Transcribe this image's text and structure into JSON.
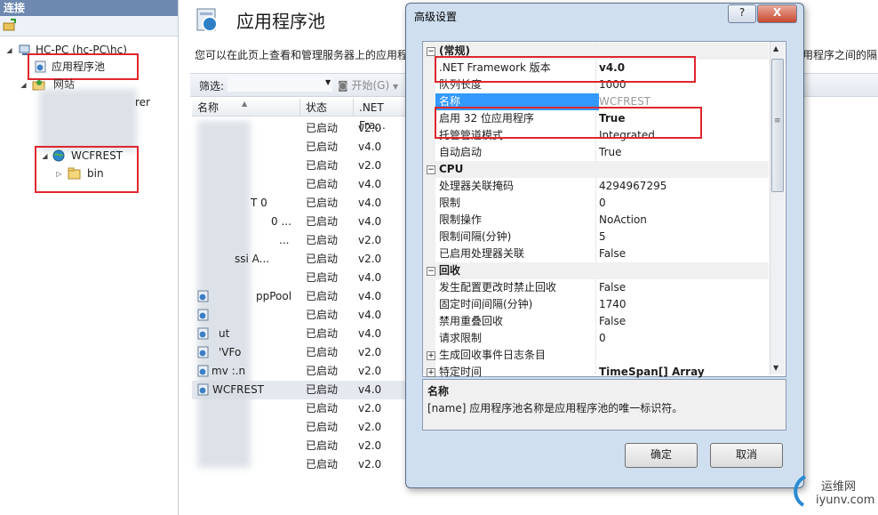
{
  "left_pane": {
    "header": "连接",
    "tree": {
      "server": "HC-PC (hc-PC\\hc)",
      "app_pools": "应用程序池",
      "sites": "网站",
      "partial_site": "rer",
      "wcfrest": "WCFREST",
      "bin": "bin"
    }
  },
  "main": {
    "title": "应用程序池",
    "description_left": "您可以在此页上查看和管理服务器上的应用程",
    "description_right": "用程序之间的隔",
    "filter_label": "筛选:",
    "start_label": "开始(G)",
    "columns": {
      "name": "名称",
      "status": "状态",
      "net": ".NET Fra..."
    },
    "partial_names": [
      "T  0",
      "0 ...",
      "...",
      "ssi      A...",
      "ppPool",
      "ut",
      "'VFo",
      "mv     :.n",
      "WCFREST"
    ],
    "rows": [
      {
        "status": "已启动",
        "net": "v2.0"
      },
      {
        "status": "已启动",
        "net": "v4.0"
      },
      {
        "status": "已启动",
        "net": "v2.0"
      },
      {
        "status": "已启动",
        "net": "v4.0"
      },
      {
        "status": "已启动",
        "net": "v4.0"
      },
      {
        "status": "已启动",
        "net": "v4.0"
      },
      {
        "status": "已启动",
        "net": "v2.0"
      },
      {
        "status": "已启动",
        "net": "v2.0"
      },
      {
        "status": "已启动",
        "net": "v4.0"
      },
      {
        "status": "已启动",
        "net": "v4.0"
      },
      {
        "status": "已启动",
        "net": "v4.0"
      },
      {
        "status": "已启动",
        "net": "v4.0"
      },
      {
        "status": "已启动",
        "net": "v2.0"
      },
      {
        "status": "已启动",
        "net": "v2.0"
      },
      {
        "status": "已启动",
        "net": "v4.0"
      },
      {
        "status": "已启动",
        "net": "v2.0"
      },
      {
        "status": "已启动",
        "net": "v2.0"
      },
      {
        "status": "已启动",
        "net": "v2.0"
      },
      {
        "status": "已启动",
        "net": "v2.0"
      }
    ]
  },
  "dialog": {
    "title": "高级设置",
    "help_button": "?",
    "close_button": "X",
    "categories": {
      "general": "(常规)",
      "cpu": "CPU",
      "recycle": "回收"
    },
    "properties": [
      {
        "name": ".NET Framework 版本",
        "value": "v4.0"
      },
      {
        "name": "队列长度",
        "value": "1000"
      },
      {
        "name": "名称",
        "value": "WCFREST"
      },
      {
        "name": "启用 32 位应用程序",
        "value": "True"
      },
      {
        "name": "托管管道模式",
        "value": "Integrated"
      },
      {
        "name": "自动启动",
        "value": "True"
      },
      {
        "name": "处理器关联掩码",
        "value": "4294967295"
      },
      {
        "name": "限制",
        "value": "0"
      },
      {
        "name": "限制操作",
        "value": "NoAction"
      },
      {
        "name": "限制间隔(分钟)",
        "value": "5"
      },
      {
        "name": "已启用处理器关联",
        "value": "False"
      },
      {
        "name": "发生配置更改时禁止回收",
        "value": "False"
      },
      {
        "name": "固定时间间隔(分钟)",
        "value": "1740"
      },
      {
        "name": "禁用重叠回收",
        "value": "False"
      },
      {
        "name": "请求限制",
        "value": "0"
      },
      {
        "name": "生成回收事件日志条目",
        "value": ""
      },
      {
        "name": "特定时间",
        "value": "TimeSpan[] Array"
      }
    ],
    "desc_title": "名称",
    "desc_text": "[name] 应用程序池名称是应用程序池的唯一标识符。",
    "ok": "确定",
    "cancel": "取消"
  },
  "watermark": {
    "cn": "运维网",
    "url": "iyunv.com"
  }
}
